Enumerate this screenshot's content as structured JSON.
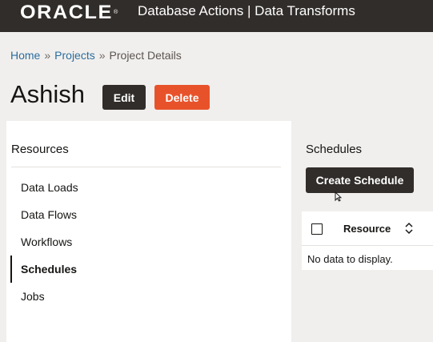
{
  "header": {
    "logo_text": "ORACLE",
    "logo_mark": "®",
    "app_title": "Database Actions | Data Transforms"
  },
  "breadcrumb": {
    "items": [
      "Home",
      "Projects",
      "Project Details"
    ],
    "separator": "»"
  },
  "project": {
    "title": "Ashish",
    "edit_label": "Edit",
    "delete_label": "Delete"
  },
  "resources": {
    "heading": "Resources",
    "items": [
      {
        "label": "Data Loads",
        "active": false
      },
      {
        "label": "Data Flows",
        "active": false
      },
      {
        "label": "Workflows",
        "active": false
      },
      {
        "label": "Schedules",
        "active": true
      },
      {
        "label": "Jobs",
        "active": false
      }
    ]
  },
  "schedules": {
    "heading": "Schedules",
    "create_label": "Create Schedule",
    "table": {
      "columns": [
        "Resource"
      ],
      "empty_message": "No data to display."
    }
  },
  "colors": {
    "header_bg": "#312d2a",
    "delete_accent": "#e8522b",
    "link": "#2b6d9e",
    "page_bg": "#f1efed"
  },
  "icons": [
    "checkbox",
    "sort-icon",
    "mouse-cursor-icon"
  ]
}
